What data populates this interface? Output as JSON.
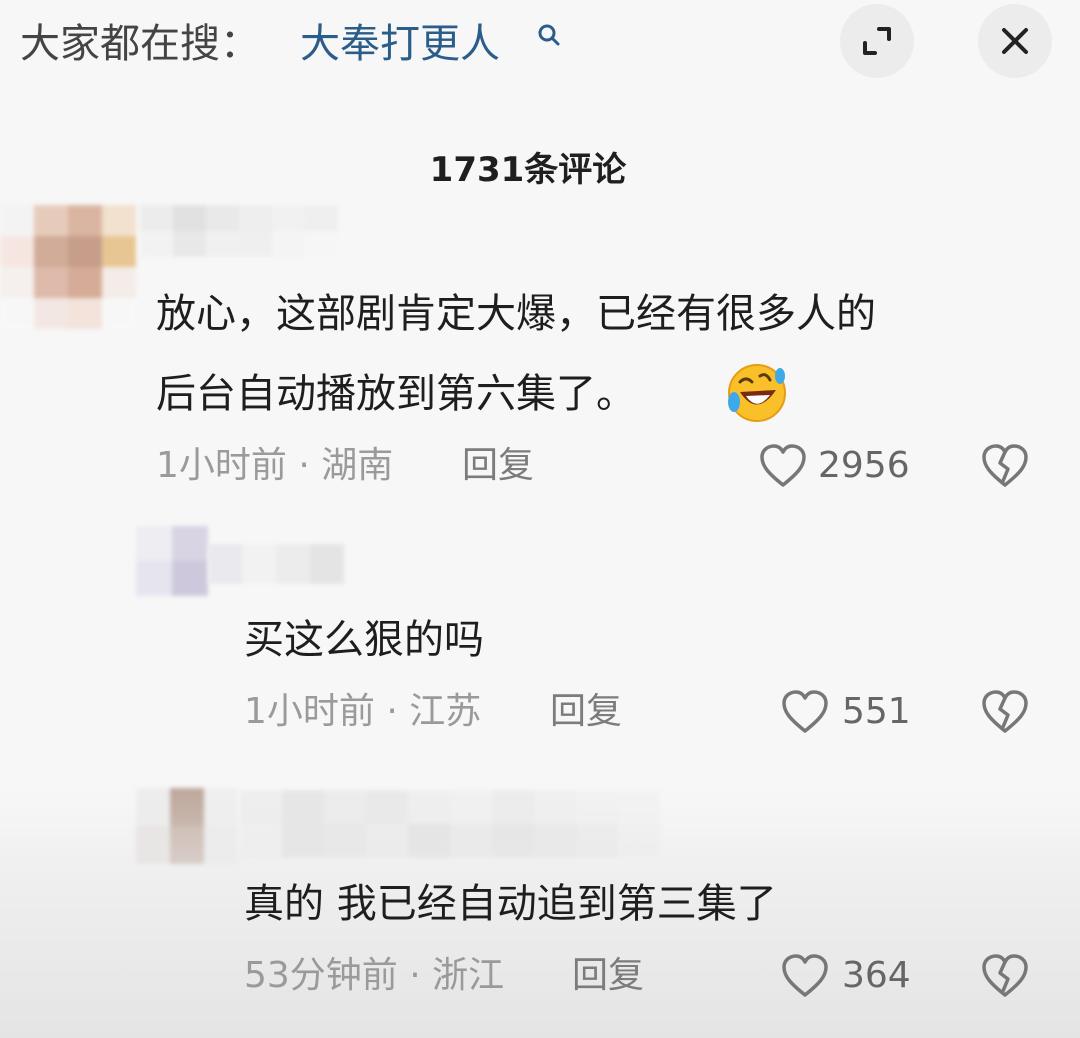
{
  "header": {
    "search_prefix": "大家都在搜：",
    "search_term": "大奉打更人"
  },
  "comments_title": "1731条评论",
  "comments": [
    {
      "text_line1": "放心，这部剧肯定大爆，已经有很多人的",
      "text_line2": "后台自动播放到第六集了。",
      "emoji": "rolling-on-floor-laughing-icon",
      "time": "1小时前 · 湖南",
      "reply": "回复",
      "likes": "2956"
    },
    {
      "text_line1": "买这么狠的吗",
      "time": "1小时前 · 江苏",
      "reply": "回复",
      "likes": "551"
    },
    {
      "text_line1": "真的  我已经自动追到第三集了",
      "time": "53分钟前 · 浙江",
      "reply": "回复",
      "likes": "364"
    }
  ],
  "colors": {
    "link": "#2a5d8a",
    "meta": "#9a9a9a",
    "background": "#f7f7f7"
  }
}
